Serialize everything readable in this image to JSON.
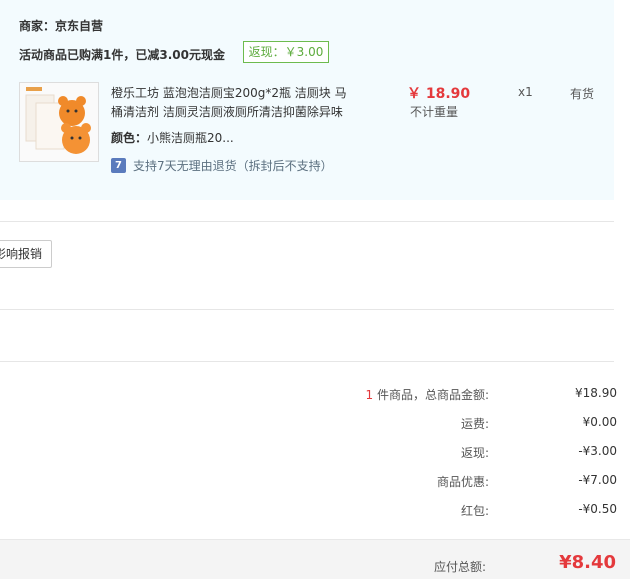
{
  "order": {
    "seller": "商家：京东自营",
    "promo": "活动商品已购满1件，已减3.00元现金",
    "rebate_tag": "返现：￥3.00",
    "item": {
      "name": "橙乐工坊 蓝泡泡洁厕宝200g*2瓶 洁厕块 马桶清洁剂 洁厕灵洁厕液厕所清洁抑菌除异味",
      "color_key": "颜色：",
      "color_val": "小熊洁厕瓶20...",
      "return_icon_text": "7",
      "return_policy": "支持7天无理由退货（拆封后不支持）",
      "price": "￥ 18.90",
      "weight": "不计重量",
      "qty": "x1",
      "stock": "有货"
    }
  },
  "invoice_button": "影响报销",
  "summary": {
    "goods_count": "1",
    "goods_label": " 件商品，总商品金额:",
    "goods_amount": "¥18.90",
    "shipping_label": "运费:",
    "shipping_amount": "¥0.00",
    "rebate_label": "返现:",
    "rebate_amount": "-¥3.00",
    "discount_label": "商品优惠:",
    "discount_amount": "-¥7.00",
    "redpacket_label": "红包:",
    "redpacket_amount": "-¥0.50"
  },
  "total": {
    "label": "应付总额:",
    "amount": "¥8.40"
  },
  "colors": {
    "accent_red": "#e4393c",
    "rebate_green": "#5cab3c",
    "panel_bg": "#f3fbfe"
  },
  "icons": [
    "product-thumbnail",
    "return-7day-icon"
  ]
}
